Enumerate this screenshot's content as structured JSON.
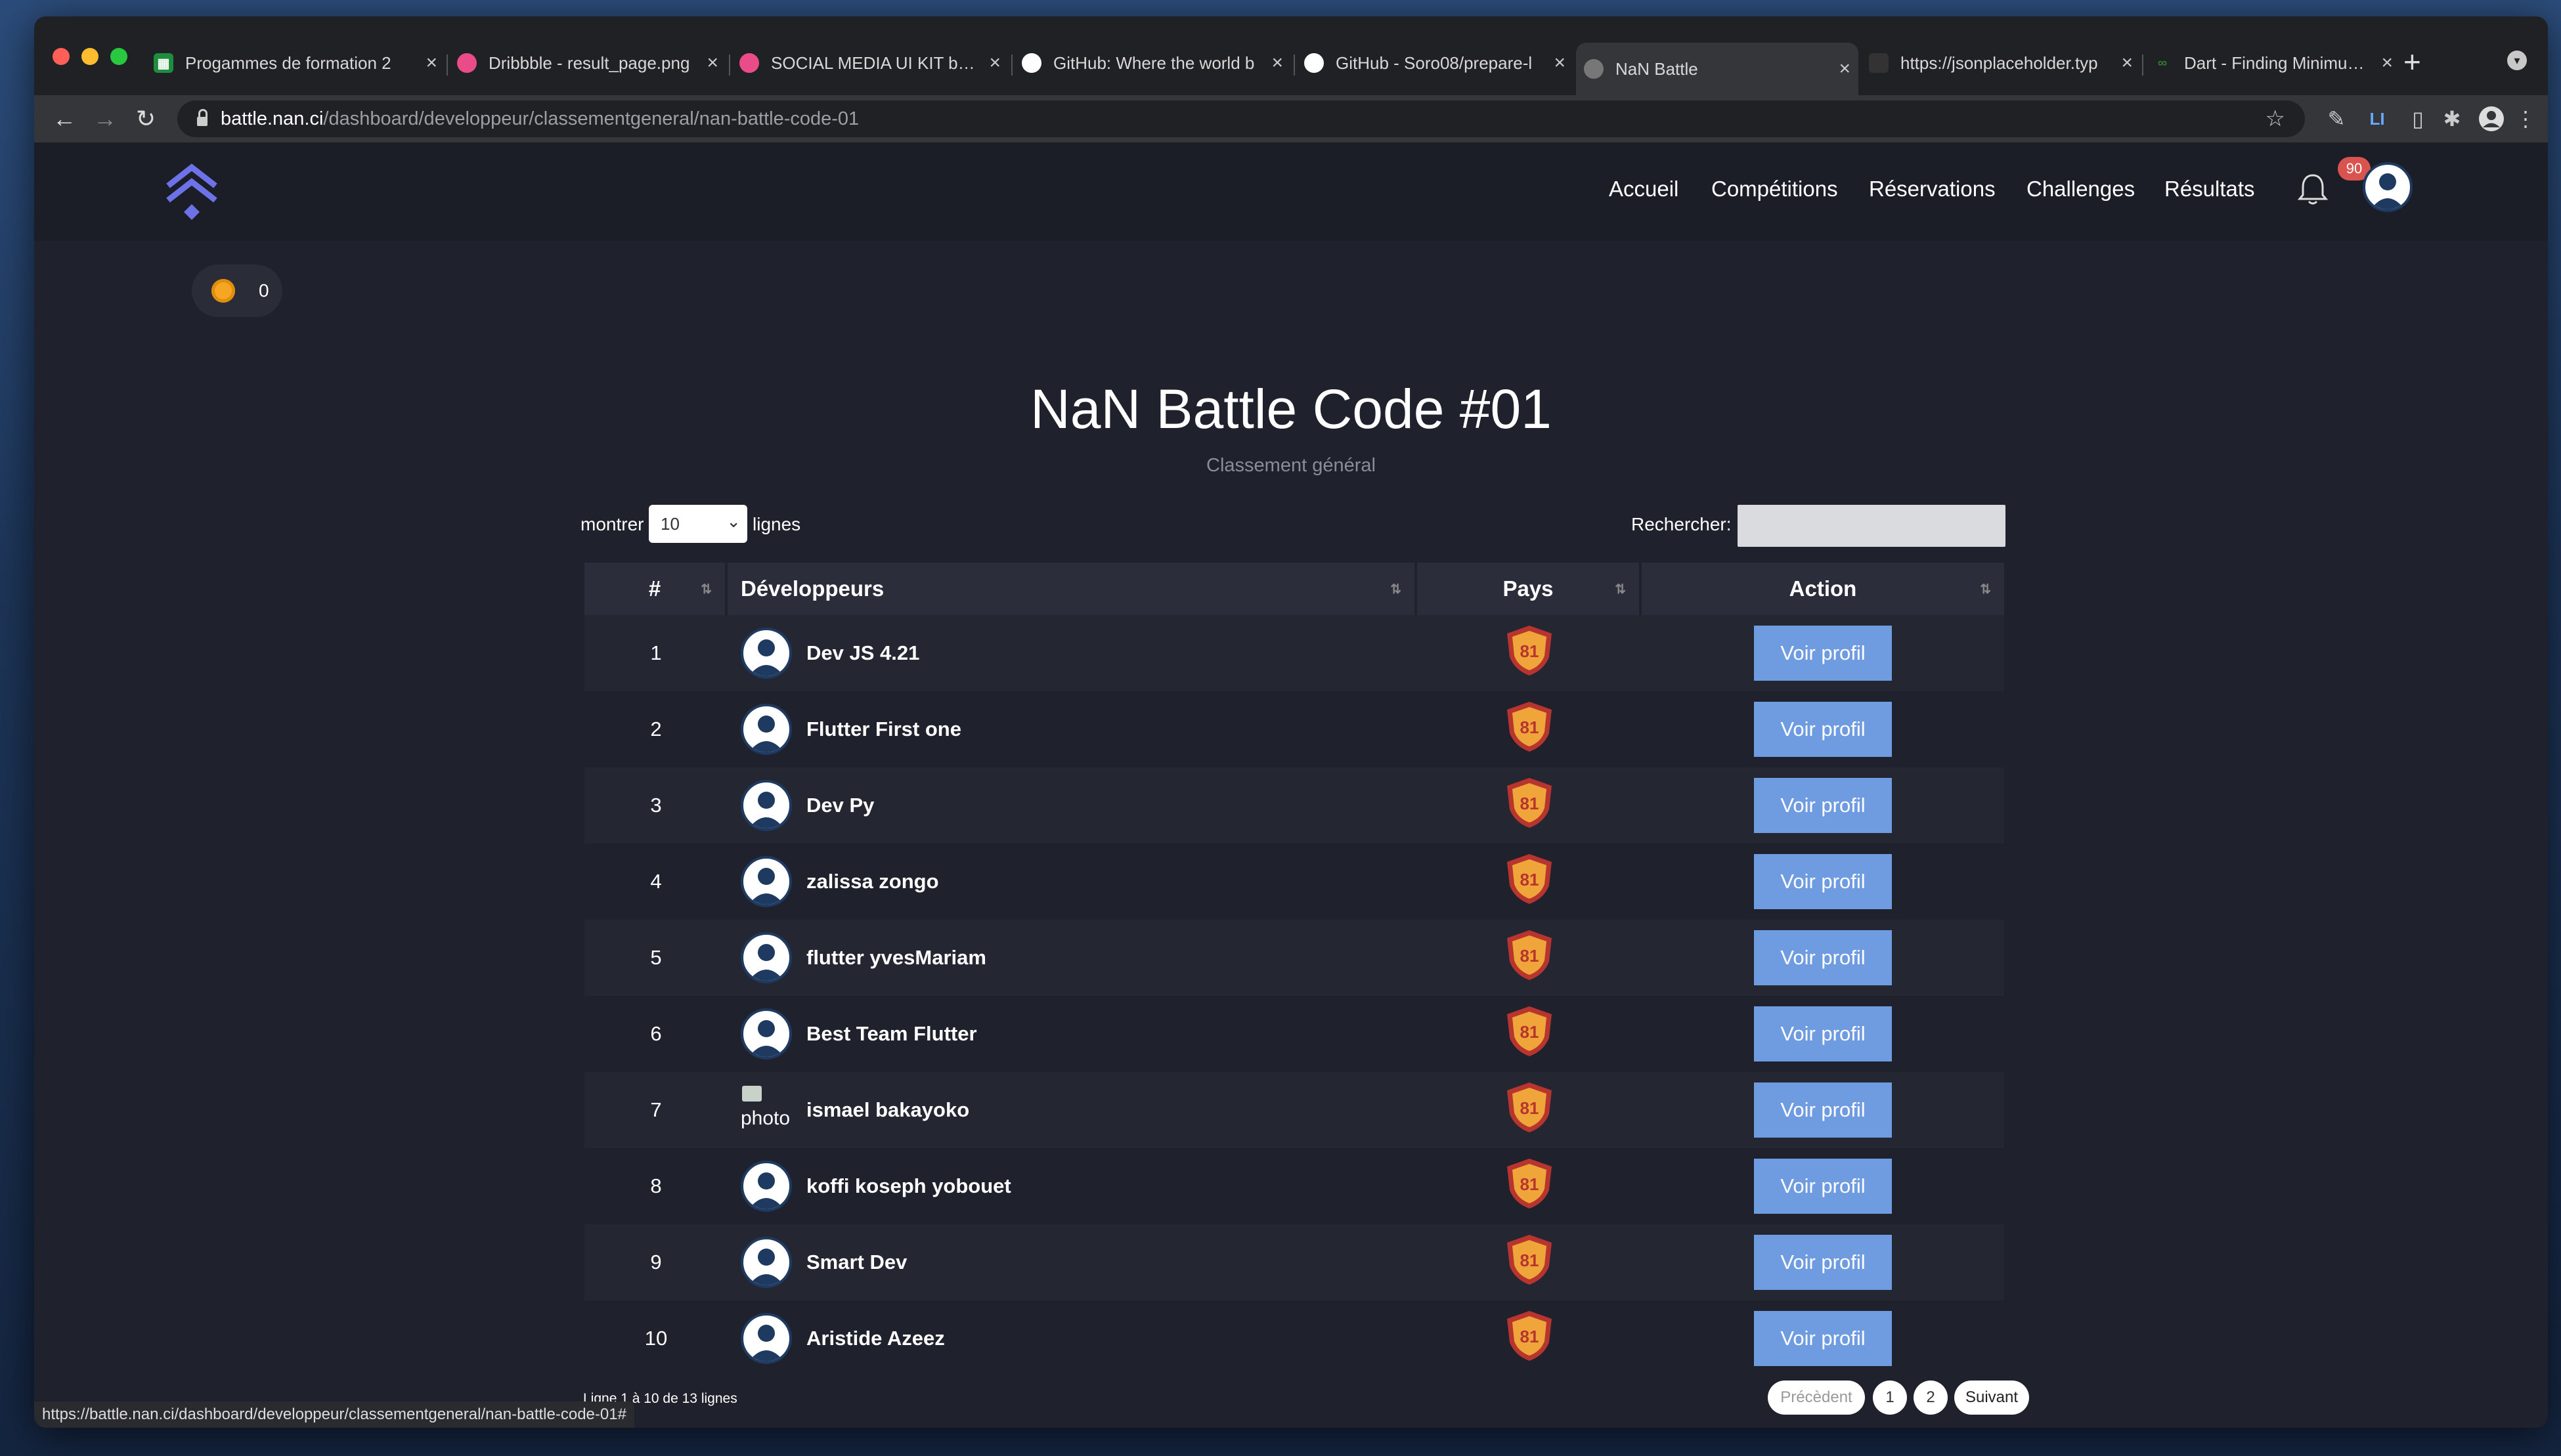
{
  "browser": {
    "tabs": [
      {
        "label": "Progammes de formation 2",
        "favicon_color": "#1e8e3e"
      },
      {
        "label": "Dribbble - result_page.png",
        "favicon_color": "#ea4c89"
      },
      {
        "label": "SOCIAL MEDIA UI KIT by J",
        "favicon_color": "#ea4c89"
      },
      {
        "label": "GitHub: Where the world b",
        "favicon_color": "#ffffff"
      },
      {
        "label": "GitHub - Soro08/prepare-l",
        "favicon_color": "#ffffff"
      },
      {
        "label": "NaN Battle",
        "favicon_color": "#777777",
        "active": true
      },
      {
        "label": "https://jsonplaceholder.typ",
        "favicon_color": "#333333"
      },
      {
        "label": "Dart - Finding Minimum an",
        "favicon_color": "#2e7d32"
      }
    ],
    "url_host": "battle.nan.ci",
    "url_path": "/dashboard/developpeur/classementgeneral/nan-battle-code-01",
    "status_url": "https://battle.nan.ci/dashboard/developpeur/classementgeneral/nan-battle-code-01#"
  },
  "nav": {
    "items": [
      "Accueil",
      "Compétitions",
      "Réservations",
      "Challenges",
      "Résultats"
    ],
    "notification_count": "90"
  },
  "coins": "0",
  "page": {
    "title": "NaN Battle Code #01",
    "subtitle": "Classement général"
  },
  "table_controls": {
    "show_label": "montrer",
    "page_size": "10",
    "lines_label": "lignes",
    "search_label": "Rechercher:"
  },
  "table": {
    "headers": [
      "#",
      "Développeurs",
      "Pays",
      "Action"
    ],
    "rows": [
      {
        "rank": "1",
        "name": "Dev JS 4.21",
        "badge": "81",
        "action": "Voir profil"
      },
      {
        "rank": "2",
        "name": "Flutter First one",
        "badge": "81",
        "action": "Voir profil"
      },
      {
        "rank": "3",
        "name": "Dev Py",
        "badge": "81",
        "action": "Voir profil"
      },
      {
        "rank": "4",
        "name": "zalissa zongo",
        "badge": "81",
        "action": "Voir profil"
      },
      {
        "rank": "5",
        "name": "flutter yvesMariam",
        "badge": "81",
        "action": "Voir profil"
      },
      {
        "rank": "6",
        "name": "Best Team Flutter",
        "badge": "81",
        "action": "Voir profil"
      },
      {
        "rank": "7",
        "name": "ismael bakayoko",
        "badge": "81",
        "action": "Voir profil",
        "broken_photo_text": "photo"
      },
      {
        "rank": "8",
        "name": "koffi koseph yobouet",
        "badge": "81",
        "action": "Voir profil"
      },
      {
        "rank": "9",
        "name": "Smart Dev",
        "badge": "81",
        "action": "Voir profil"
      },
      {
        "rank": "10",
        "name": "Aristide Azeez",
        "badge": "81",
        "action": "Voir profil"
      }
    ]
  },
  "footer": {
    "info": "Ligne 1 à 10 de 13 lignes",
    "prev": "Précèdent",
    "pages": [
      "1",
      "2"
    ],
    "next": "Suivant"
  },
  "colors": {
    "accent": "#6f9be0",
    "background": "#1f222c",
    "logo": "#6d72e8",
    "badge_red": "#d9534f"
  }
}
